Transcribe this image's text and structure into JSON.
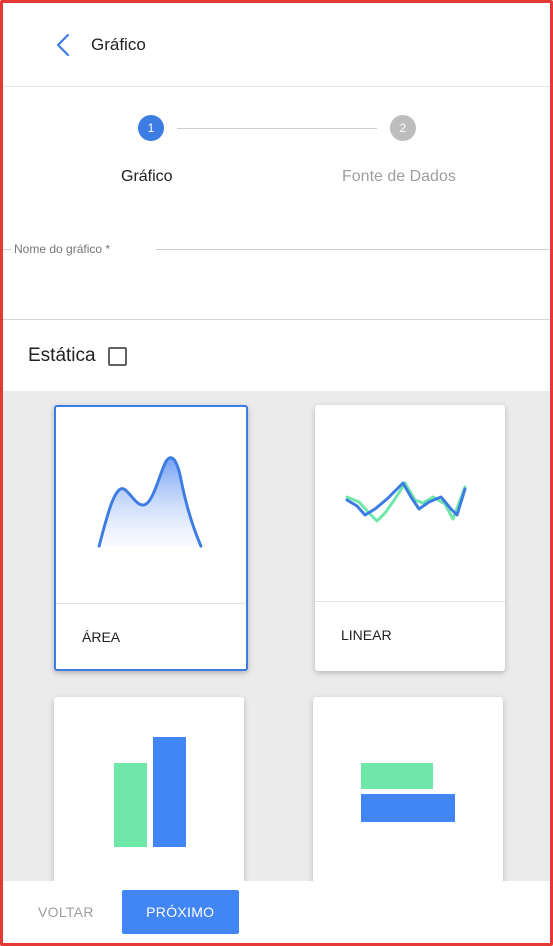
{
  "header": {
    "title": "Gráfico",
    "back_icon": "chevron-left-icon"
  },
  "stepper": {
    "steps": [
      {
        "number": "1",
        "label": "Gráfico",
        "active": true
      },
      {
        "number": "2",
        "label": "Fonte de Dados",
        "active": false
      }
    ]
  },
  "form": {
    "name_field": {
      "label": "Nome do gráfico *",
      "value": ""
    },
    "static_label": "Estática",
    "static_checked": false
  },
  "chart_types": [
    {
      "label": "ÁREA",
      "selected": true,
      "icon": "area-chart-icon"
    },
    {
      "label": "LINEAR",
      "selected": false,
      "icon": "line-chart-icon"
    },
    {
      "label": "",
      "selected": false,
      "icon": "bar-chart-icon"
    },
    {
      "label": "",
      "selected": false,
      "icon": "horizontal-bar-chart-icon"
    }
  ],
  "footer": {
    "back_label": "VOLTAR",
    "next_label": "PRÓXIMO"
  },
  "colors": {
    "primary": "#4285f4",
    "accent_green": "#6ee7a8",
    "frame": "#e53935"
  }
}
